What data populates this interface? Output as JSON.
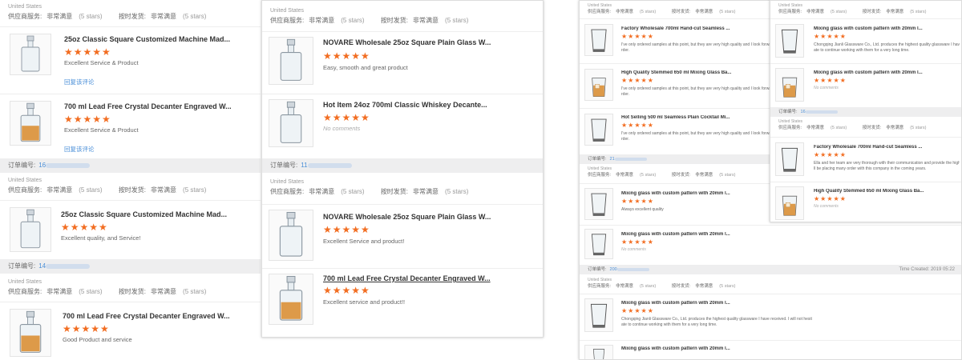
{
  "colors": {
    "star": "#f26d21",
    "link": "#4a8fd8",
    "bar": "#eeeeef"
  },
  "labels": {
    "supplier_service": "供应商服务:",
    "on_time": "按时发货:",
    "very_satisfied": "非常满意",
    "five_stars": "(5 stars)",
    "order_no": "订单编号:",
    "reply": "回复该评论",
    "location": "United States",
    "stars": "★★★★★",
    "no_comments": "No comments"
  },
  "panel_a": {
    "order_numbers": [
      "16",
      "14"
    ],
    "items": [
      {
        "title": "25oz Classic Square Customized Machine Mad...",
        "comment": "Excellent Service & Product",
        "icon": "decanter-icon"
      },
      {
        "title": "700 ml Lead Free Crystal Decanter Engraved W...",
        "comment": "Excellent Service & Product",
        "icon": "whiskey-decanter-icon"
      },
      {
        "title": "25oz Classic Square Customized Machine Mad...",
        "comment": "Excellent quality, and Service!",
        "icon": "decanter-icon"
      },
      {
        "title": "700 ml Lead Free Crystal Decanter Engraved W...",
        "comment": "Good Product and service",
        "icon": "whiskey-decanter-icon"
      }
    ]
  },
  "panel_b": {
    "order_numbers": [
      "11"
    ],
    "items": [
      {
        "title": "NOVARE Wholesale 25oz Square Plain Glass W...",
        "comment": "Easy, smooth and great product",
        "icon": "decanter-icon"
      },
      {
        "title": "Hot Item 24oz 700ml Classic Whiskey Decante...",
        "comment": "No comments",
        "icon": "decanter-icon"
      },
      {
        "title": "NOVARE Wholesale 25oz Square Plain Glass W...",
        "comment": "Excellent Service and product!",
        "icon": "decanter-icon"
      },
      {
        "title": "700 ml Lead Free Crystal Decanter Engraved W...",
        "comment": "Excellent service and product!!",
        "icon": "whiskey-decanter-icon"
      }
    ]
  },
  "panel_c": {
    "order_numbers": [
      "21",
      "200"
    ],
    "time_created": "Time Created: 2019 05:22",
    "items": [
      {
        "title": "Factory Wholesale 700ml Hand-cut Seamless ...",
        "comment": "I've only ordered samples at this point, but they are very high quality and I look forwa",
        "comment2": "rder.",
        "icon": "mixing-glass-icon"
      },
      {
        "title": "High Quality Stemmed 650 ml Mixing Glass Ba...",
        "comment": "I've only ordered samples at this point, but they are very high quality and I look forwa",
        "comment2": "rder.",
        "icon": "whiskey-glass-icon"
      },
      {
        "title": "Hot Selling 500 ml Seamless Plain Cocktail Mi...",
        "comment": "I've only ordered samples at this point, but they are very high quality and I look forwa",
        "comment2": "rder.",
        "icon": "mixing-glass-icon"
      },
      {
        "title": "Mixing glass with custom pattern with 20mm l...",
        "comment": "Always excellent quality",
        "icon": "mixing-glass-icon"
      },
      {
        "title": "Mixing glass with custom pattern with 20mm l...",
        "comment": "No comments",
        "icon": "mixing-glass-icon"
      },
      {
        "title": "Mixing glass with custom pattern with 20mm l...",
        "comment": "Chongqing Jianli Glassware Co., Ltd. produces the highest quality glassware I have received. I will not hesit",
        "comment2": "ate to continue working with them for a very long time.",
        "icon": "mixing-glass-icon"
      },
      {
        "title": "Mixing glass with custom pattern with 20mm l...",
        "comment": "",
        "icon": "mixing-glass-icon"
      }
    ]
  },
  "panel_d": {
    "order_numbers": [
      "16"
    ],
    "items": [
      {
        "title": "Mixing glass with custom pattern with 20mm l...",
        "comment": "Chongqing Jianli Glassware Co., Ltd. produces the highest quality glassware I have rec",
        "comment2": "ate to continue working with them for a very long time.",
        "icon": "mixing-glass-icon"
      },
      {
        "title": "Mixing glass with custom pattern with 20mm l...",
        "comment": "No comments",
        "icon": "whiskey-glass-icon"
      },
      {
        "title": "Factory Wholesale 700ml Hand-cut Seamless ...",
        "comment": "Ella and her team are very thorough with their communication and provide the highest",
        "comment2": "ll be placing many order with this company in the coming years.",
        "icon": "mixing-glass-icon"
      },
      {
        "title": "High Quality Stemmed 650 ml Mixing Glass Ba...",
        "comment": "No comments",
        "icon": "whiskey-glass-icon"
      }
    ]
  }
}
